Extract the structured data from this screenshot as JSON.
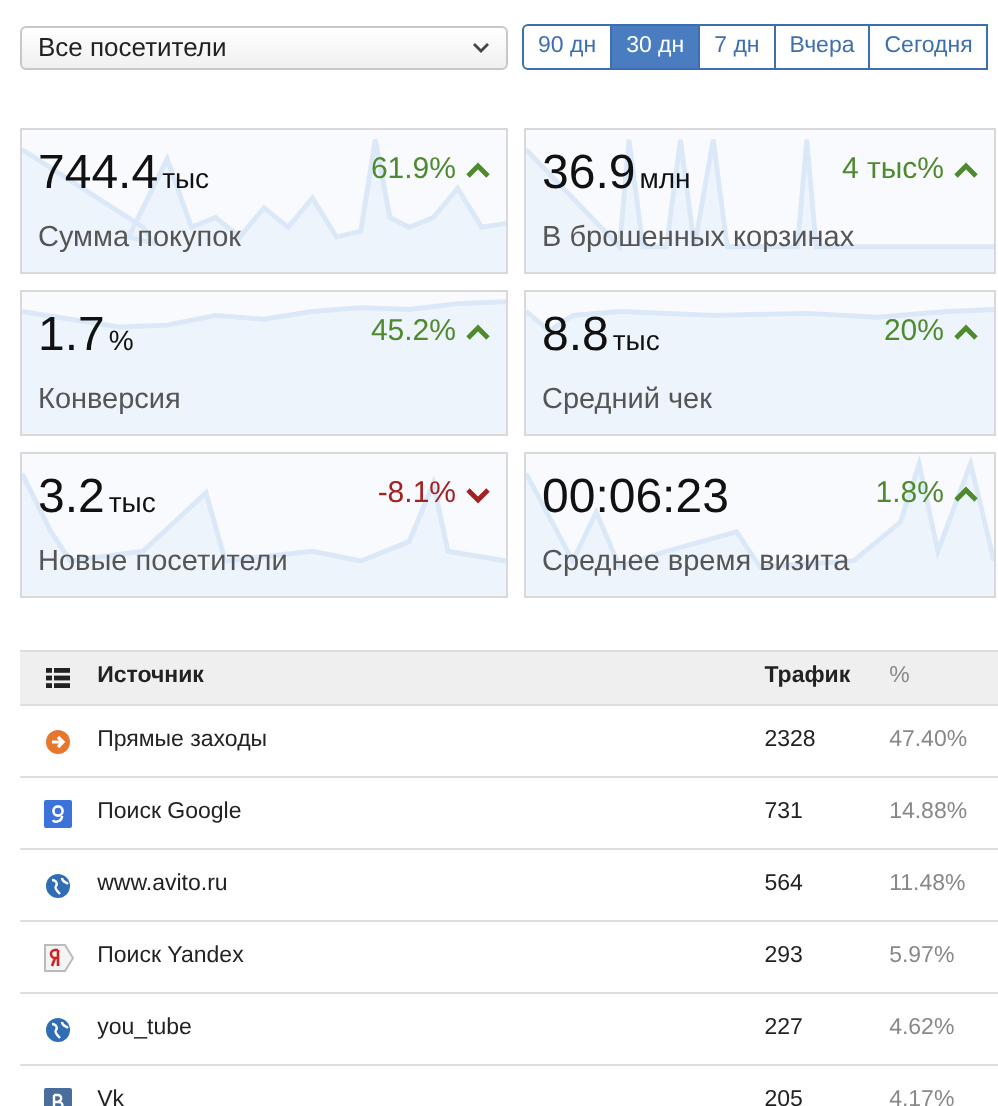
{
  "filter": {
    "value": "Все посетители"
  },
  "periods": [
    {
      "label": "90 дн",
      "selected": false
    },
    {
      "label": "30 дн",
      "selected": true
    },
    {
      "label": "7 дн",
      "selected": false
    },
    {
      "label": "Вчера",
      "selected": false
    },
    {
      "label": "Сегодня",
      "selected": false
    }
  ],
  "metrics": [
    {
      "value": "744.4",
      "unit": "тыс",
      "change": "61.9%",
      "rising": true,
      "label": "Сумма покупок"
    },
    {
      "value": "36.9",
      "unit": "млн",
      "change": "4 тыс%",
      "rising": true,
      "label": "В брошенных корзинах"
    },
    {
      "value": "1.7",
      "unit": "%",
      "change": "45.2%",
      "rising": true,
      "label": "Конверсия"
    },
    {
      "value": "8.8",
      "unit": "тыс",
      "change": "20%",
      "rising": true,
      "label": "Средний чек"
    },
    {
      "value": "3.2",
      "unit": "тыс",
      "change": "-8.1%",
      "rising": false,
      "label": "Новые посетители"
    },
    {
      "value": "00:06:23",
      "change": "1.8%",
      "rising": true,
      "label": "Среднее время визита"
    }
  ],
  "table": {
    "columns": [
      "Источник",
      "Трафик",
      "%"
    ],
    "rows": [
      {
        "kind": "direct",
        "source": "Прямые заходы",
        "traffic": "2328",
        "share": "47.40%"
      },
      {
        "kind": "search-blue",
        "source": "Поиск Google",
        "traffic": "731",
        "share": "14.88%"
      },
      {
        "kind": "site",
        "source": "www.avito.ru",
        "traffic": "564",
        "share": "11.48%"
      },
      {
        "kind": "search-red",
        "source": "Поиск Yandex",
        "traffic": "293",
        "share": "5.97%"
      },
      {
        "kind": "site",
        "source": "you_tube",
        "traffic": "227",
        "share": "4.62%"
      },
      {
        "kind": "social",
        "source": "Vk",
        "traffic": "205",
        "share": "4.17%"
      }
    ]
  }
}
